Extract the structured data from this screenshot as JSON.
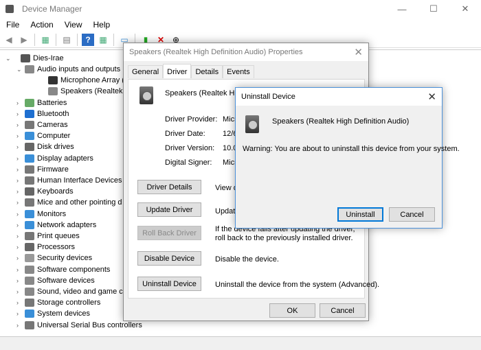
{
  "window": {
    "title": "Device Manager",
    "minimize": "—",
    "maximize": "☐",
    "close": "✕"
  },
  "menu": [
    "File",
    "Action",
    "View",
    "Help"
  ],
  "tree": {
    "root": "Dies-Irae",
    "items": [
      {
        "label": "Audio inputs and outputs",
        "level": 1,
        "expanded": true,
        "color": "#888"
      },
      {
        "label": "Microphone Array (Rea",
        "level": 2,
        "color": "#333"
      },
      {
        "label": "Speakers (Realtek High",
        "level": 2,
        "color": "#888"
      },
      {
        "label": "Batteries",
        "level": 1,
        "color": "#6a6"
      },
      {
        "label": "Bluetooth",
        "level": 1,
        "color": "#1e6fd0"
      },
      {
        "label": "Cameras",
        "level": 1,
        "color": "#777"
      },
      {
        "label": "Computer",
        "level": 1,
        "color": "#3a8fd8"
      },
      {
        "label": "Disk drives",
        "level": 1,
        "color": "#666"
      },
      {
        "label": "Display adapters",
        "level": 1,
        "color": "#3a8fd8"
      },
      {
        "label": "Firmware",
        "level": 1,
        "color": "#777"
      },
      {
        "label": "Human Interface Devices",
        "level": 1,
        "color": "#777"
      },
      {
        "label": "Keyboards",
        "level": 1,
        "color": "#666"
      },
      {
        "label": "Mice and other pointing d",
        "level": 1,
        "color": "#777"
      },
      {
        "label": "Monitors",
        "level": 1,
        "color": "#3a8fd8"
      },
      {
        "label": "Network adapters",
        "level": 1,
        "color": "#3a8fd8"
      },
      {
        "label": "Print queues",
        "level": 1,
        "color": "#777"
      },
      {
        "label": "Processors",
        "level": 1,
        "color": "#666"
      },
      {
        "label": "Security devices",
        "level": 1,
        "color": "#999"
      },
      {
        "label": "Software components",
        "level": 1,
        "color": "#888"
      },
      {
        "label": "Software devices",
        "level": 1,
        "color": "#888"
      },
      {
        "label": "Sound, video and game co",
        "level": 1,
        "color": "#888"
      },
      {
        "label": "Storage controllers",
        "level": 1,
        "color": "#777"
      },
      {
        "label": "System devices",
        "level": 1,
        "color": "#3a8fd8"
      },
      {
        "label": "Universal Serial Bus controllers",
        "level": 1,
        "color": "#777"
      }
    ]
  },
  "properties": {
    "title": "Speakers (Realtek High Definition Audio) Properties",
    "tabs": [
      "General",
      "Driver",
      "Details",
      "Events"
    ],
    "device_name": "Speakers (Realtek High",
    "fields": [
      {
        "label": "Driver Provider:",
        "value": "Micro"
      },
      {
        "label": "Driver Date:",
        "value": "12/6"
      },
      {
        "label": "Driver Version:",
        "value": "10.0"
      },
      {
        "label": "Digital Signer:",
        "value": "Micro"
      }
    ],
    "actions": [
      {
        "button": "Driver Details",
        "desc": "View de",
        "disabled": false
      },
      {
        "button": "Update Driver",
        "desc": "Update",
        "disabled": false
      },
      {
        "button": "Roll Back Driver",
        "desc": "If the device fails after updating the driver, roll back to the previously installed driver.",
        "disabled": true
      },
      {
        "button": "Disable Device",
        "desc": "Disable the device.",
        "disabled": false
      },
      {
        "button": "Uninstall Device",
        "desc": "Uninstall the device from the system (Advanced).",
        "disabled": false
      }
    ],
    "ok": "OK",
    "cancel": "Cancel"
  },
  "uninstall": {
    "title": "Uninstall Device",
    "device": "Speakers (Realtek High Definition Audio)",
    "warning": "Warning: You are about to uninstall this device from your system.",
    "uninstall": "Uninstall",
    "cancel": "Cancel"
  }
}
